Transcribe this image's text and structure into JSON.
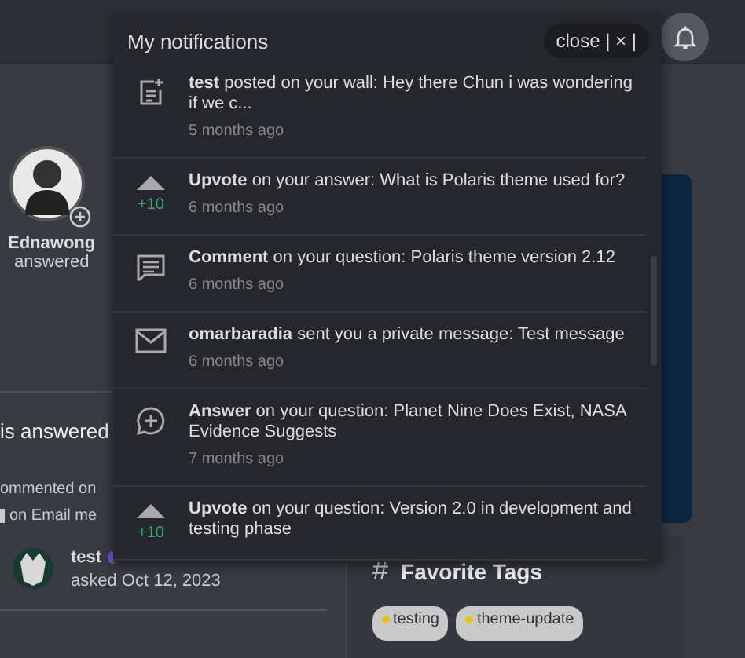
{
  "page": {
    "user": {
      "name": "Ednawong",
      "action": "answered"
    },
    "heading": "is answered",
    "activity": [
      "ommented on",
      "on Email me"
    ],
    "question": {
      "author": "test",
      "asked": "asked Oct 12, 2023"
    },
    "favorite_tags": {
      "icon": "#",
      "title": "Favorite Tags",
      "tags": [
        {
          "label": "testing",
          "color": "#e8c21a"
        },
        {
          "label": "theme-update",
          "color": "#e8c21a"
        }
      ]
    }
  },
  "notifications": {
    "title": "My notifications",
    "close": "close | × |",
    "items": [
      {
        "kind": "post",
        "text": "**test** posted on your wall: Hey there Chun i was wondering if we c...",
        "time": "5 months ago"
      },
      {
        "kind": "upvote",
        "score": "+10",
        "text": "**Upvote** on your answer: What is Polaris theme used for?",
        "time": "6 months ago"
      },
      {
        "kind": "comment",
        "text": "**Comment** on your question: Polaris theme version 2.12",
        "time": "6 months ago"
      },
      {
        "kind": "message",
        "text": "**omarbaradia** sent you a private message: Test message",
        "time": "6 months ago"
      },
      {
        "kind": "answer",
        "text": "**Answer** on your question: Planet Nine Does Exist, NASA Evidence Suggests",
        "time": "7 months ago"
      },
      {
        "kind": "upvote",
        "score": "+10",
        "text": "**Upvote** on your question: Version 2.0 in development and testing phase"
      }
    ]
  }
}
